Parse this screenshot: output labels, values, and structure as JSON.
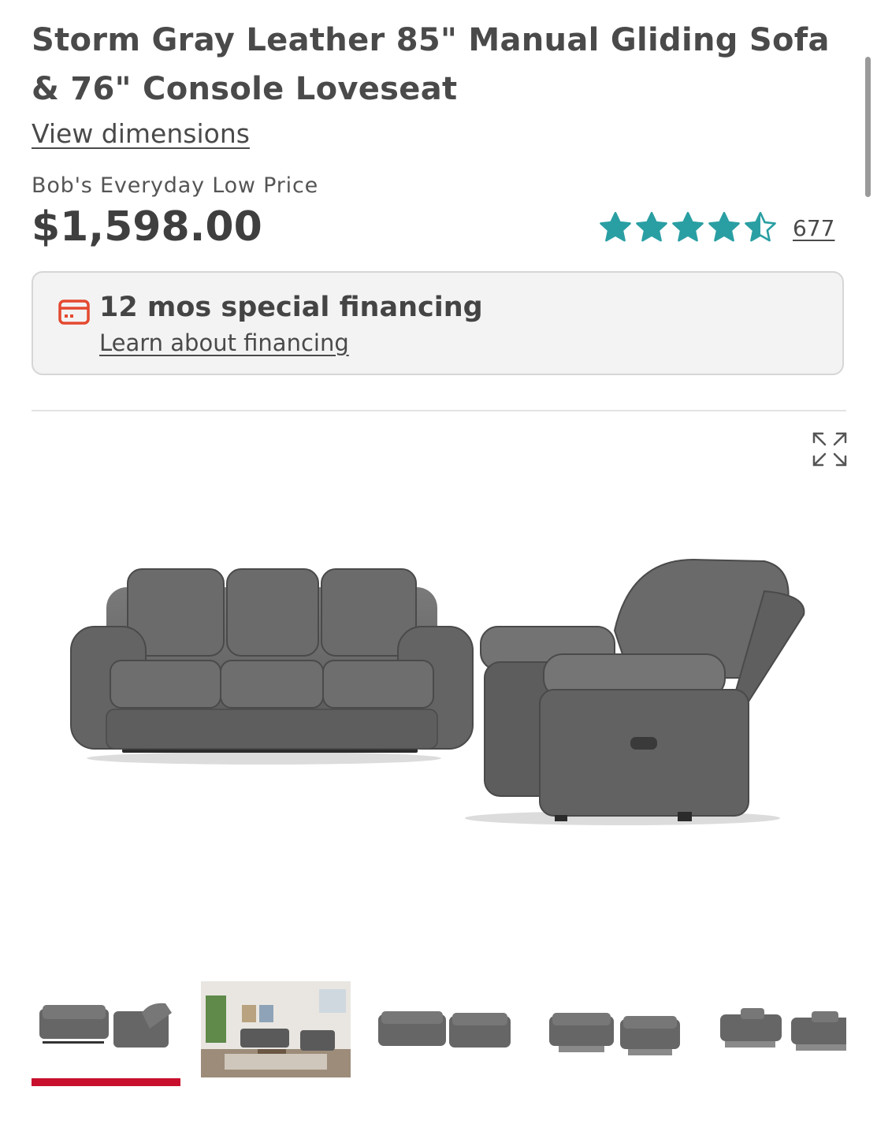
{
  "product": {
    "title": "Storm Gray Leather 85\" Manual Gliding Sofa & 76\" Console Loveseat",
    "dimensions_link": "View dimensions",
    "price_label": "Bob's Everyday Low Price",
    "price": "$1,598.00",
    "rating": 4.5,
    "rating_max": 5,
    "review_count": "677"
  },
  "financing": {
    "title": "12 mos special financing",
    "link": "Learn about financing",
    "icon": "credit-card-icon"
  },
  "gallery": {
    "expand_icon": "expand-icon",
    "selected_index": 0,
    "thumbnail_count": 5
  },
  "colors": {
    "star": "#2a9fa3",
    "accent_red": "#c8102e",
    "card_icon": "#e4492f",
    "text": "#3d3d3d"
  }
}
